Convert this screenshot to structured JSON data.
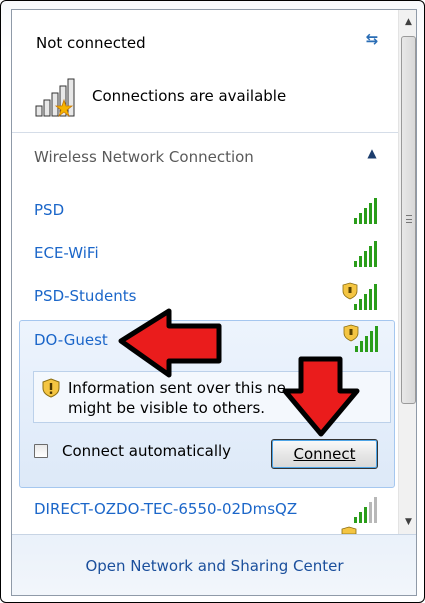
{
  "status": {
    "title": "Not connected",
    "refresh_icon": "refresh-arrows-icon",
    "available_text": "Connections are available",
    "available_icon": "signal-bars-star-icon"
  },
  "section": {
    "title": "Wireless Network Connection",
    "collapse_icon": "chevron-up-icon"
  },
  "networks": [
    {
      "name": "PSD",
      "secured": false,
      "signal_bars": 5
    },
    {
      "name": "ECE-WiFi",
      "secured": false,
      "signal_bars": 5
    },
    {
      "name": "PSD-Students",
      "secured": true,
      "signal_bars": 5
    },
    {
      "name": "DO-Guest",
      "secured": true,
      "signal_bars": 5,
      "expanded": true
    },
    {
      "name": "DIRECT-OZDO-TEC-6550-02DmsQZ",
      "secured": false,
      "signal_bars": 3
    }
  ],
  "expanded": {
    "warning_line1": "Information sent over this ne",
    "warning_line2": "might be visible to others.",
    "auto_label": "Connect automatically",
    "auto_checked": false,
    "connect_label": "Connect"
  },
  "footer": {
    "link": "Open Network and Sharing Center"
  },
  "colors": {
    "link": "#1b66c9",
    "signal": "#2a9d1a",
    "annotation_arrow": "#ea1c1c"
  }
}
